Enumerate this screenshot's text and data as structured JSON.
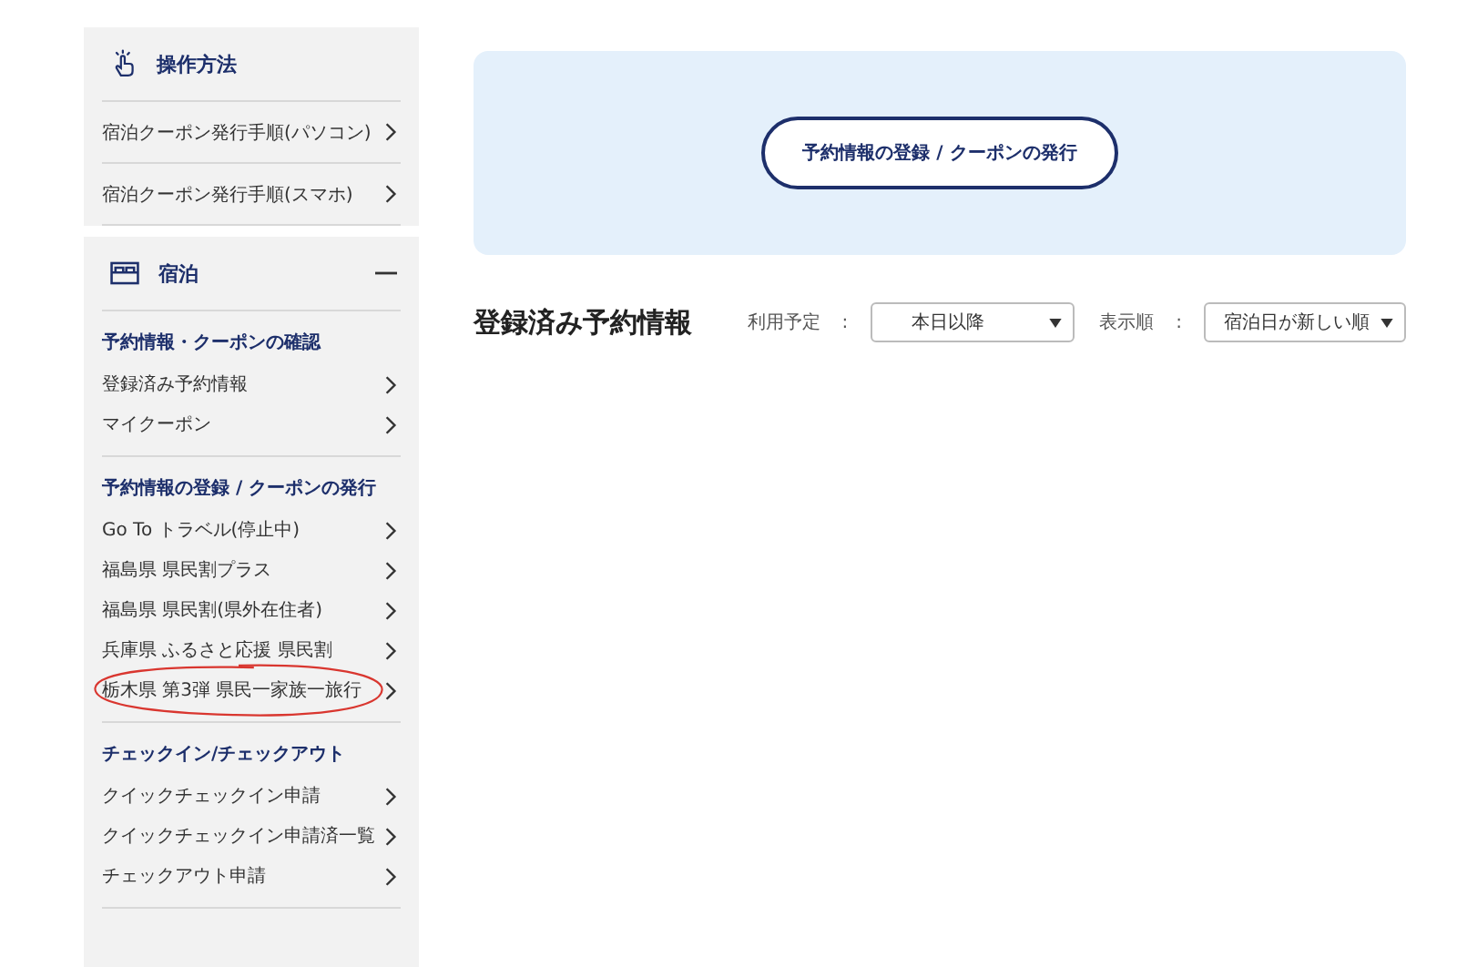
{
  "sidebar": {
    "guide": {
      "title": "操作方法",
      "items": [
        {
          "label": "宿泊クーポン発行手順(パソコン)"
        },
        {
          "label": "宿泊クーポン発行手順(スマホ)"
        }
      ]
    },
    "stay": {
      "title": "宿泊",
      "expanded": true,
      "sections": [
        {
          "heading": "予約情報・クーポンの確認",
          "items": [
            {
              "label": "登録済み予約情報",
              "circled": false
            },
            {
              "label": "マイクーポン",
              "circled": false
            }
          ]
        },
        {
          "heading": "予約情報の登録 / クーポンの発行",
          "items": [
            {
              "label": "Go To トラベル(停止中)",
              "circled": false
            },
            {
              "label": "福島県 県民割プラス",
              "circled": false
            },
            {
              "label": "福島県 県民割(県外在住者)",
              "circled": false
            },
            {
              "label": "兵庫県 ふるさと応援 県民割",
              "circled": false
            },
            {
              "label": "栃木県 第3弾 県民一家族一旅行",
              "circled": true
            }
          ]
        },
        {
          "heading": "チェックイン/チェックアウト",
          "items": [
            {
              "label": "クイックチェックイン申請",
              "circled": false
            },
            {
              "label": "クイックチェックイン申請済一覧",
              "circled": false
            },
            {
              "label": "チェックアウト申請",
              "circled": false
            }
          ]
        }
      ]
    }
  },
  "main": {
    "banner_button": "予約情報の登録 / クーポンの発行",
    "heading": "登録済み予約情報",
    "filters": [
      {
        "label": "利用予定",
        "separator": ":",
        "value": "本日以降"
      },
      {
        "label": "表示順",
        "separator": ":",
        "value": "宿泊日が新しい順"
      }
    ]
  }
}
